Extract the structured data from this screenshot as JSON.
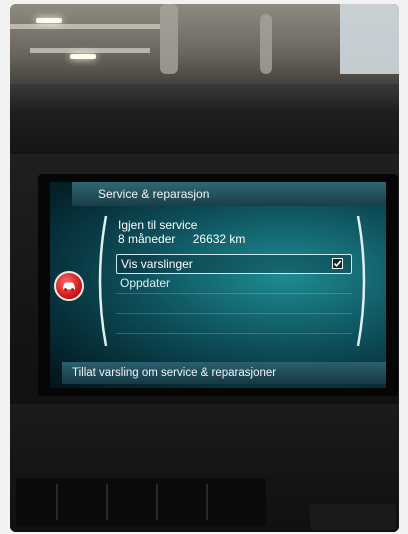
{
  "screen": {
    "header_title": "Service & reparasjon",
    "info_line1": "Igjen til service",
    "info_months": "8 måneder",
    "info_km": "26632 km",
    "menu_items": [
      {
        "label": "Vis varslinger",
        "checked": true
      },
      {
        "label": "Oppdater"
      },
      {
        "label": ""
      },
      {
        "label": ""
      }
    ],
    "footer_text": "Tillat varsling om service & reparasjoner"
  },
  "icons": {
    "status_badge": "car-icon",
    "checkbox": "checkmark-icon"
  },
  "colors": {
    "screen_accent": "#1f8c93",
    "badge_red": "#d11a1a"
  }
}
